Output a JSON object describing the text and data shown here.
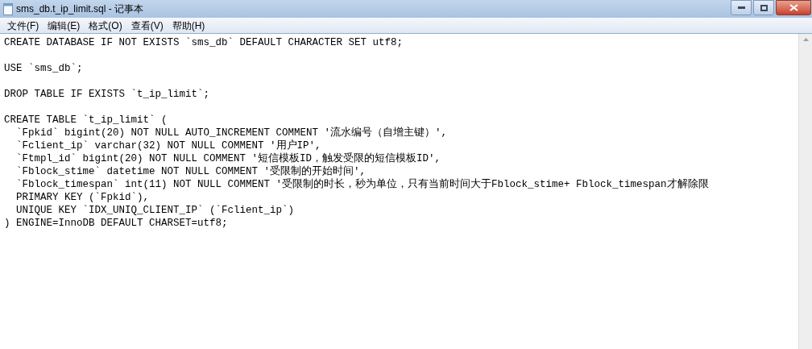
{
  "window": {
    "title": "sms_db.t_ip_limit.sql - 记事本"
  },
  "menu": [
    "文件(F)",
    "编辑(E)",
    "格式(O)",
    "查看(V)",
    "帮助(H)"
  ],
  "statements": [
    [
      "CREATE DATABASE IF NOT EXISTS `sms_db` DEFAULT CHARACTER SET utf8;"
    ],
    [
      "USE `sms_db`;"
    ],
    [
      "DROP TABLE IF EXISTS `t_ip_limit`;"
    ],
    [
      "CREATE TABLE `t_ip_limit` (",
      "  `Fpkid` bigint(20) NOT NULL AUTO_INCREMENT COMMENT '流水编号（自增主键）',",
      "  `Fclient_ip` varchar(32) NOT NULL COMMENT '用户IP',",
      "  `Ftmpl_id` bigint(20) NOT NULL COMMENT '短信模板ID，触发受限的短信模板ID',",
      "  `Fblock_stime` datetime NOT NULL COMMENT '受限制的开始时间',",
      "  `Fblock_timespan` int(11) NOT NULL COMMENT '受限制的时长，秒为单位，只有当前时间大于Fblock_stime+ Fblock_timespan才解除限",
      "  PRIMARY KEY (`Fpkid`),",
      "  UNIQUE KEY `IDX_UNIQ_CLIENT_IP` (`Fclient_ip`)",
      ") ENGINE=InnoDB DEFAULT CHARSET=utf8;"
    ]
  ]
}
